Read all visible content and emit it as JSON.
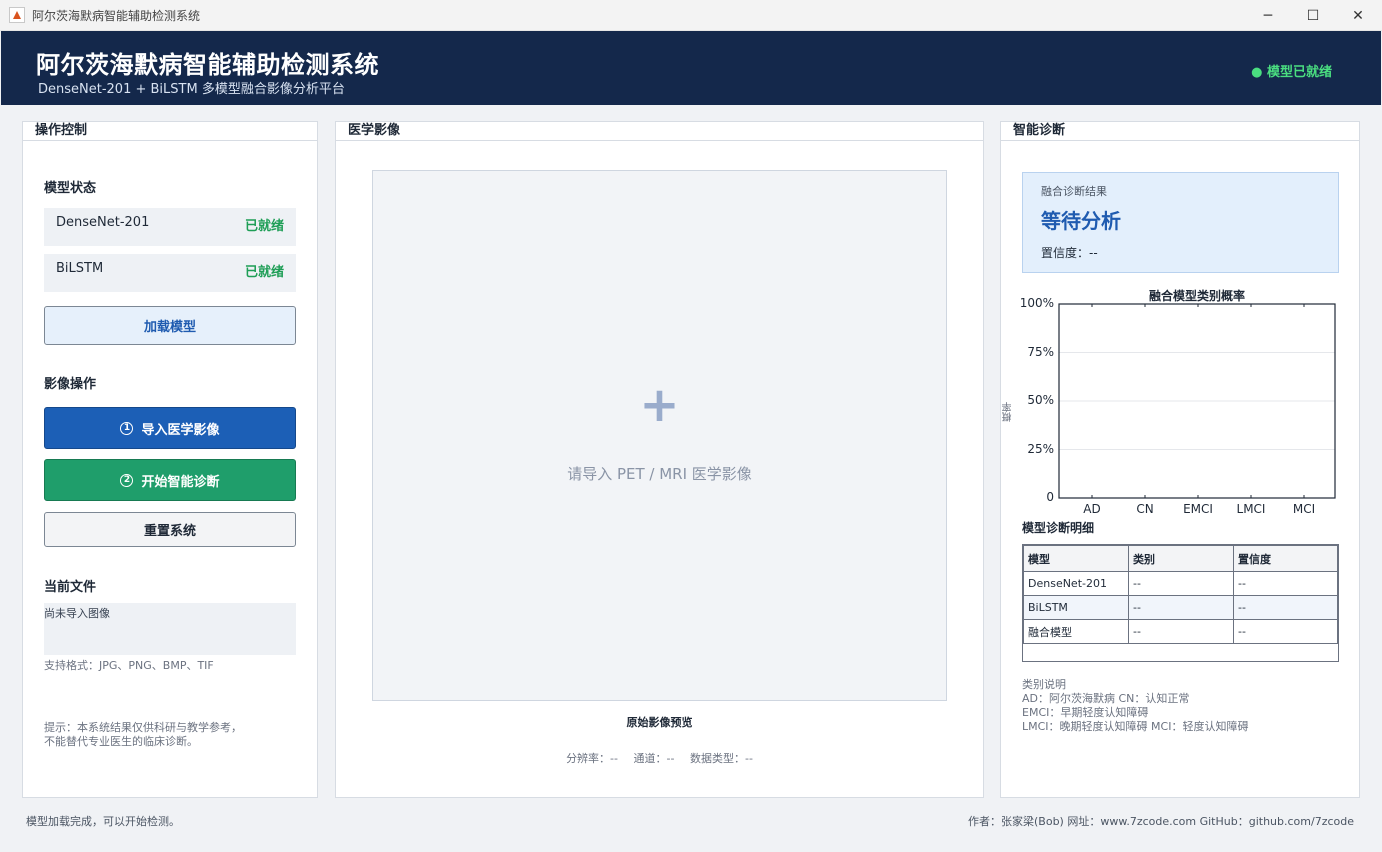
{
  "window": {
    "title": "阿尔茨海默病智能辅助检测系统",
    "minimize": "─",
    "maximize": "☐",
    "close": "✕"
  },
  "header": {
    "title": "阿尔茨海默病智能辅助检测系统",
    "subtitle": "DenseNet-201 + BiLSTM 多模型融合影像分析平台",
    "status": "● 模型已就绪",
    "status_color": "#4ade80"
  },
  "control": {
    "title": "操作控制",
    "model_section": "模型状态",
    "models": [
      {
        "name": "DenseNet-201",
        "status": "已就绪"
      },
      {
        "name": "BiLSTM",
        "status": "已就绪"
      }
    ],
    "load_button": "加载模型",
    "image_section": "影像操作",
    "import_num": "1",
    "import_button": "导入医学影像",
    "diagnose_num": "2",
    "diagnose_button": "开始智能诊断",
    "reset_button": "重置系统",
    "file_section": "当前文件",
    "file_value": "尚未导入图像",
    "formats": "支持格式：JPG、PNG、BMP、TIF",
    "notice_line1": "提示：本系统结果仅供科研与教学参考，",
    "notice_line2": "不能替代专业医生的临床诊断。"
  },
  "imaging": {
    "title": "医学影像",
    "plus": "+",
    "placeholder": "请导入 PET / MRI 医学影像",
    "preview_label": "原始影像预览",
    "resolution": "分辨率：--",
    "channels": "通道：--",
    "dtype": "数据类型：--"
  },
  "diagnosis": {
    "title": "智能诊断",
    "result_label": "融合诊断结果",
    "result_value": "等待分析",
    "confidence": "置信度：--",
    "detail_title": "模型诊断明细",
    "table_headers": [
      "模型",
      "类别",
      "置信度"
    ],
    "table_rows": [
      [
        "DenseNet-201",
        "--",
        "--"
      ],
      [
        "BiLSTM",
        "--",
        "--"
      ],
      [
        "融合模型",
        "--",
        "--"
      ]
    ],
    "legend_title": "类别说明",
    "legend_line1": "AD：阿尔茨海默病     CN：认知正常",
    "legend_line2": "EMCI：早期轻度认知障碍",
    "legend_line3": "LMCI：晚期轻度认知障碍     MCI：轻度认知障碍"
  },
  "chart_data": {
    "type": "bar",
    "title": "融合模型类别概率",
    "ylabel": "概率",
    "xlabel": "",
    "categories": [
      "AD",
      "CN",
      "EMCI",
      "LMCI",
      "MCI"
    ],
    "values": [
      0,
      0,
      0,
      0,
      0
    ],
    "ylim": [
      0,
      1
    ],
    "yticks": [
      0,
      0.25,
      0.5,
      0.75,
      1
    ],
    "ytick_labels": [
      "0",
      "25%",
      "50%",
      "75%",
      "100%"
    ],
    "grid": true
  },
  "statusbar": {
    "message": "模型加载完成，可以开始检测。",
    "credits": "作者：张家梁(Bob)  网址：www.7zcode.com  GitHub：github.com/7zcode"
  }
}
